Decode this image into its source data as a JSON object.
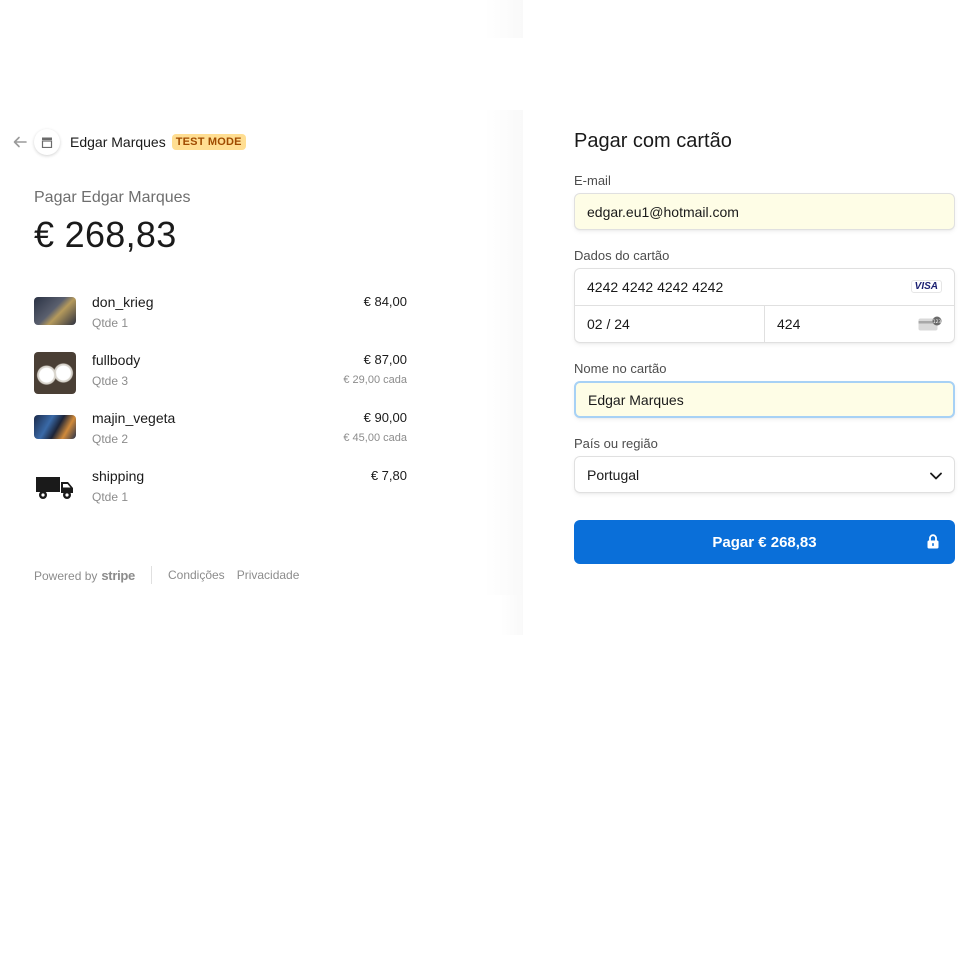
{
  "merchant": {
    "name": "Edgar Marques",
    "badge": "TEST MODE"
  },
  "summary": {
    "pay_to": "Pagar Edgar Marques",
    "total": "€ 268,83"
  },
  "line_items": [
    {
      "name": "don_krieg",
      "qty": "Qtde 1",
      "price": "€ 84,00",
      "unit": "",
      "thumb": "dark-photo"
    },
    {
      "name": "fullbody",
      "qty": "Qtde 3",
      "price": "€ 87,00",
      "unit": "€ 29,00 cada",
      "thumb": "white-figures-photo"
    },
    {
      "name": "majin_vegeta",
      "qty": "Qtde 2",
      "price": "€ 90,00",
      "unit": "€ 45,00 cada",
      "thumb": "blue-figure-photo"
    },
    {
      "name": "shipping",
      "qty": "Qtde 1",
      "price": "€ 7,80",
      "unit": "",
      "thumb": "truck-icon"
    }
  ],
  "footer": {
    "powered_by": "Powered by",
    "stripe": "stripe",
    "terms": "Condições",
    "privacy": "Privacidade"
  },
  "form": {
    "title": "Pagar com cartão",
    "email_label": "E-mail",
    "email_value": "edgar.eu1@hotmail.com",
    "card_label": "Dados do cartão",
    "card_number": "4242 4242 4242 4242",
    "card_brand": "VISA",
    "card_expiry": "02 / 24",
    "card_cvc": "424",
    "name_label": "Nome no cartão",
    "name_value": "Edgar Marques",
    "country_label": "País ou região",
    "country_value": "Portugal",
    "pay_button": "Pagar € 268,83"
  },
  "colors": {
    "primary": "#0a6fd9",
    "badge_bg": "#ffde92",
    "badge_text": "#a04b00",
    "autofill_bg": "#fefde6"
  }
}
